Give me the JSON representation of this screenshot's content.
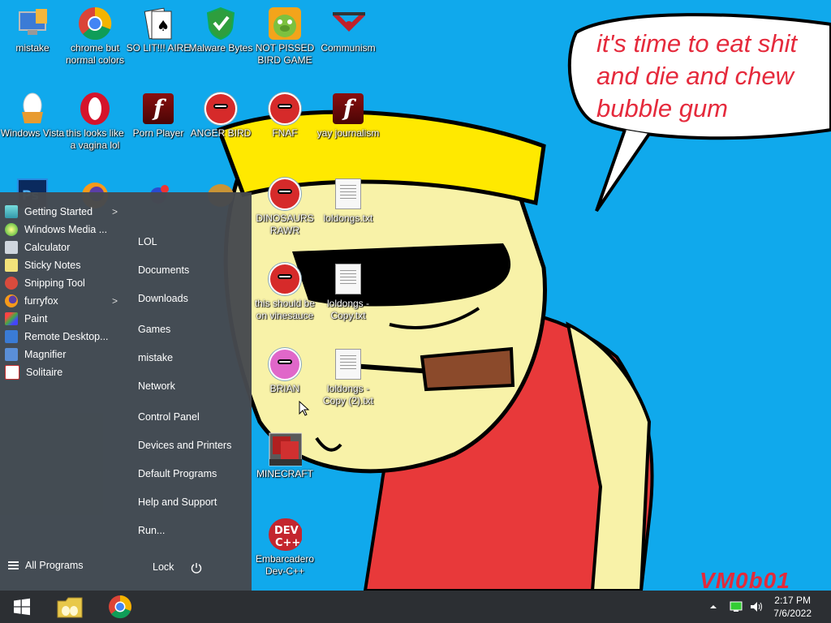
{
  "desktop": {
    "speech_text": "it's time to eat shit\nand die and chew\nbubble gum",
    "signature": "VM0b01",
    "icons": [
      {
        "label": "mistake"
      },
      {
        "label": "chrome but normal colors"
      },
      {
        "label": "SO LIT!!! AIRE"
      },
      {
        "label": "Malware Bytes"
      },
      {
        "label": "NOT PISSED BIRD GAME"
      },
      {
        "label": "Communism"
      },
      {
        "label": "Windows Vista"
      },
      {
        "label": "this looks like a vagina lol"
      },
      {
        "label": "Porn Player"
      },
      {
        "label": "ANGER BIRD"
      },
      {
        "label": "FNAF"
      },
      {
        "label": "yay journalism"
      },
      {
        "label": "DINOSAURS RAWR"
      },
      {
        "label": "loldongs.txt"
      },
      {
        "label": "this should be on vinesauce"
      },
      {
        "label": "loldongs - Copy.txt"
      },
      {
        "label": "BRIAN"
      },
      {
        "label": "loldongs - Copy (2).txt"
      },
      {
        "label": "MINECRAFT"
      },
      {
        "label": "Embarcadero Dev-C++"
      }
    ]
  },
  "start_menu": {
    "programs": [
      {
        "label": "Getting Started",
        "has_submenu": true
      },
      {
        "label": "Windows Media ...",
        "has_submenu": false
      },
      {
        "label": "Calculator",
        "has_submenu": false
      },
      {
        "label": "Sticky Notes",
        "has_submenu": false
      },
      {
        "label": "Snipping Tool",
        "has_submenu": false
      },
      {
        "label": "furryfox",
        "has_submenu": true
      },
      {
        "label": "Paint",
        "has_submenu": false
      },
      {
        "label": "Remote Desktop...",
        "has_submenu": false
      },
      {
        "label": "Magnifier",
        "has_submenu": false
      },
      {
        "label": "Solitaire",
        "has_submenu": false
      }
    ],
    "submenu_arrow": ">",
    "right_links": [
      "LOL",
      "Documents",
      "Downloads",
      "Games",
      "mistake",
      "Network",
      "Control Panel",
      "Devices and Printers",
      "Default Programs",
      "Help and Support",
      "Run..."
    ],
    "all_programs": "All Programs",
    "lock": "Lock"
  },
  "taskbar": {
    "time": "2:17 PM",
    "date": "7/6/2022",
    "icons": [
      "windows-start-icon",
      "file-explorer-icon",
      "chrome-icon",
      "tray-expand-icon",
      "network-icon",
      "volume-icon"
    ]
  }
}
